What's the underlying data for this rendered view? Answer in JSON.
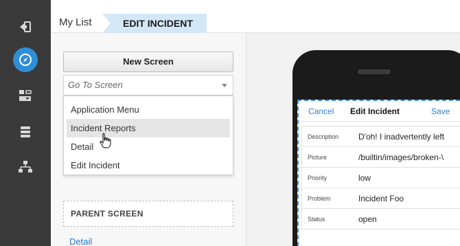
{
  "rail": {
    "icons": [
      "exit-icon",
      "compass-icon",
      "screens-icon",
      "database-icon",
      "hierarchy-icon"
    ]
  },
  "breadcrumb": {
    "home": "My List",
    "active": "EDIT INCIDENT"
  },
  "panel": {
    "new_screen_label": "New Screen",
    "goto_placeholder": "Go To Screen",
    "menu_items": [
      "Application Menu",
      "Incident Reports",
      "Detail",
      "Edit Incident"
    ],
    "hovered_item": "Incident Reports",
    "parent_screen_heading": "PARENT SCREEN",
    "parent_link": "Detail"
  },
  "device": {
    "nav": {
      "cancel": "Cancel",
      "title": "Edit Incident",
      "save": "Save"
    },
    "rows": [
      {
        "label": "Description",
        "value": "D'oh! I inadvertently left"
      },
      {
        "label": "Picture",
        "value": "/builtin/images/broken-\\"
      },
      {
        "label": "Priority",
        "value": "low"
      },
      {
        "label": "Problem",
        "value": "Incident Foo"
      },
      {
        "label": "Status",
        "value": "open"
      }
    ]
  },
  "colors": {
    "rail_bg": "#3a3a3a",
    "accent_blue": "#2e8fd8",
    "link_blue": "#2a7ac7",
    "breadcrumb_active_bg": "#d4e7f7"
  }
}
